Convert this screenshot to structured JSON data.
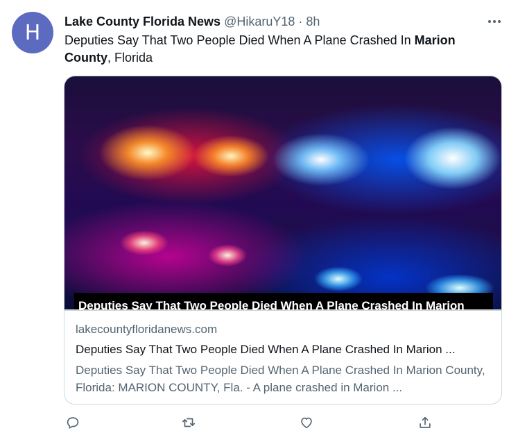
{
  "author": {
    "avatar_letter": "H",
    "name": "Lake County Florida News",
    "handle": "@HikaruY18",
    "separator": "·",
    "time": "8h"
  },
  "tweet": {
    "text_before": "Deputies Say That Two People Died When A Plane Crashed In ",
    "text_bold": "Marion County",
    "text_after": ", Florida"
  },
  "card": {
    "image_caption": "Deputies Say That Two People Died When A Plane Crashed In Marion",
    "domain": "lakecountyfloridanews.com",
    "title": "Deputies Say That Two People Died When A Plane Crashed In Marion ...",
    "description": "Deputies Say That Two People Died When A Plane Crashed In Marion County, Florida: MARION COUNTY, Fla. - A plane crashed in Marion ..."
  },
  "icons": {
    "more": "more-icon",
    "reply": "reply-icon",
    "retweet": "retweet-icon",
    "like": "like-icon",
    "share": "share-icon"
  },
  "colors": {
    "avatar": "#5c6bc0",
    "secondary_text": "#536471",
    "border": "#cfd9de"
  }
}
